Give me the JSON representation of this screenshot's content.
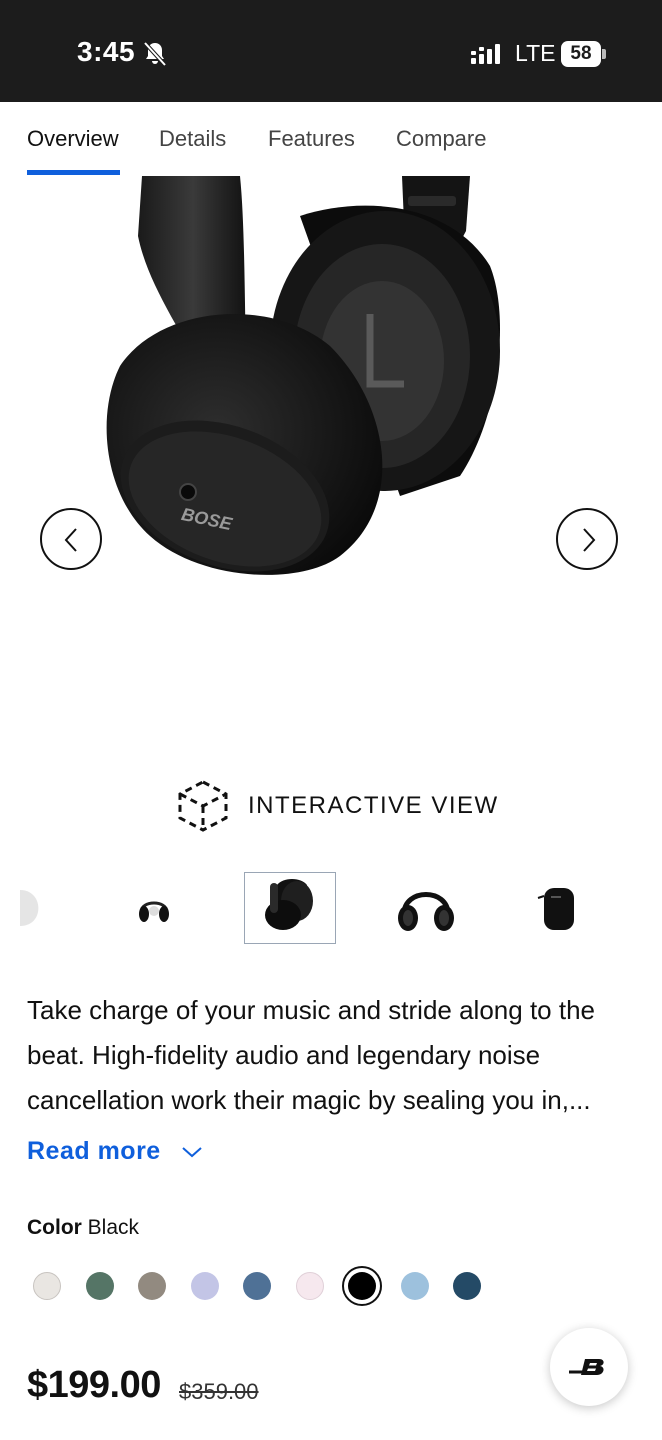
{
  "status_bar": {
    "time": "3:45",
    "network": "LTE",
    "battery": "58"
  },
  "tabs": [
    {
      "label": "Overview",
      "active": true
    },
    {
      "label": "Details",
      "active": false
    },
    {
      "label": "Features",
      "active": false
    },
    {
      "label": "Compare",
      "active": false
    }
  ],
  "hero": {
    "brand_mark": "BOSE",
    "ear_marking": "L"
  },
  "interactive_view": {
    "label": "INTERACTIVE VIEW"
  },
  "description": {
    "text": "Take charge of your music and stride along to the beat. High-fidelity audio and legendary noise cancellation work their magic by sealing you in,...",
    "read_more": "Read more"
  },
  "color": {
    "label": "Color",
    "selected": "Black",
    "swatches": [
      "#e9e6e2",
      "#557566",
      "#928a80",
      "#c3c5e6",
      "#4f7196",
      "#f6e8ee",
      "#000000",
      "#9dc1dd",
      "#244a66"
    ],
    "selected_index": 6
  },
  "price": {
    "current": "$199.00",
    "original": "$359.00"
  },
  "colors": {
    "accent": "#0f5fdc",
    "status_bar": "#1c1c1c"
  }
}
